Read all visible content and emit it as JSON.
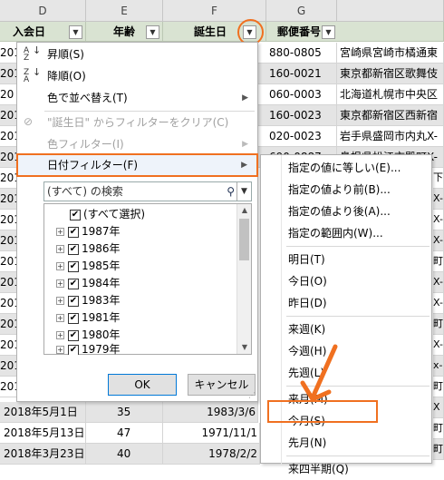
{
  "columns": [
    "D",
    "E",
    "F",
    "G"
  ],
  "headers": {
    "join_date": "入会日",
    "age": "年齢",
    "birthday": "誕生日",
    "postal_code": "郵便番号"
  },
  "filter_glyph": "▼",
  "right_rows": [
    {
      "code": "880-0805",
      "addr": "宮崎県宮崎市橘通東"
    },
    {
      "code": "160-0021",
      "addr": "東京都新宿区歌舞伎"
    },
    {
      "code": "060-0003",
      "addr": "北海道札幌市中央区"
    },
    {
      "code": "160-0023",
      "addr": "東京都新宿区西新宿"
    },
    {
      "code": "020-0023",
      "addr": "岩手県盛岡市内丸X-"
    },
    {
      "code": "690-0887",
      "addr": "島根県松江市殿町X-"
    }
  ],
  "right_edge_chars": [
    "下",
    "X-",
    "X-",
    "X-",
    "町",
    "X-",
    "X-",
    "町",
    "X-",
    "x-",
    "町",
    "X",
    "町",
    "町",
    "X"
  ],
  "left_edge": [
    "201",
    "201",
    "20",
    "201",
    "201",
    "201",
    "201",
    "201",
    "201",
    "201",
    "201",
    "201",
    "201",
    "201",
    "201",
    "201",
    "201",
    "201"
  ],
  "bottom_rows": [
    {
      "join": "2018年5月1日",
      "age": "35",
      "bday": "1983/3/6"
    },
    {
      "join": "2018年5月13日",
      "age": "47",
      "bday": "1971/11/1"
    },
    {
      "join": "2018年3月23日",
      "age": "40",
      "bday": "1978/2/2"
    }
  ],
  "menu": {
    "sort_asc": "昇順(S)",
    "sort_desc": "降順(O)",
    "sort_color": "色で並べ替え(T)",
    "clear_filter": "\"誕生日\" からフィルターをクリア(C)",
    "color_filter": "色フィルター(I)",
    "date_filter": "日付フィルター(F)",
    "search_placeholder": "(すべて) の検索",
    "select_all": "(すべて選択)",
    "years": [
      "1987年",
      "1986年",
      "1985年",
      "1984年",
      "1983年",
      "1981年",
      "1980年",
      "1979年"
    ],
    "ok": "OK",
    "cancel": "キャンセル"
  },
  "submenu": [
    "指定の値に等しい(E)...",
    "指定の値より前(B)...",
    "指定の値より後(A)...",
    "指定の範囲内(W)...",
    "明日(T)",
    "今日(O)",
    "昨日(D)",
    "来週(K)",
    "今週(H)",
    "先週(L)",
    "来月(M)",
    "今月(S)",
    "先月(N)",
    "来四半期(Q)"
  ],
  "accent_color": "#f07020"
}
